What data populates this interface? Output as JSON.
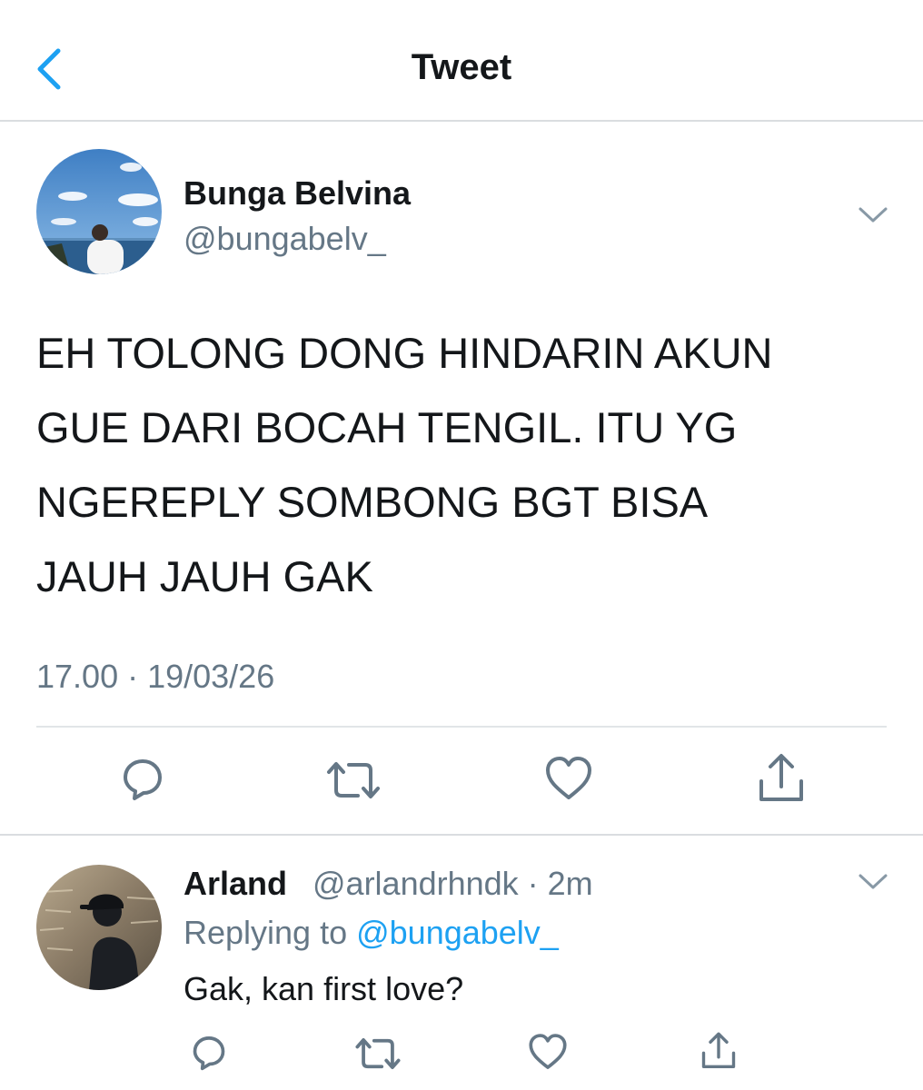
{
  "header": {
    "title": "Tweet",
    "back_icon": "chevron-left-icon",
    "accent_color": "#1da1f2"
  },
  "main_tweet": {
    "display_name": "Bunga Belvina",
    "handle": "@bungabelv_",
    "text": "EH TOLONG DONG HINDARIN AKUN\nGUE DARI BOCAH TENGIL. ITU YG\nNGEREPLY SOMBONG BGT BISA\nJAUH JAUH GAK",
    "timestamp": "17.00 · 19/03/26",
    "actions": [
      "reply-icon",
      "retweet-icon",
      "like-icon",
      "share-icon"
    ]
  },
  "reply_tweet": {
    "display_name": "Arland",
    "meta": "@arlandrhndk · 2m",
    "replying_prefix": "Replying to ",
    "replying_mention": "@bungabelv_",
    "text": "Gak, kan first love?",
    "actions": [
      "reply-icon",
      "retweet-icon",
      "like-icon",
      "share-icon"
    ]
  },
  "colors": {
    "text_primary": "#14171a",
    "text_secondary": "#657786",
    "link": "#1da1f2",
    "divider": "#dadde0"
  }
}
